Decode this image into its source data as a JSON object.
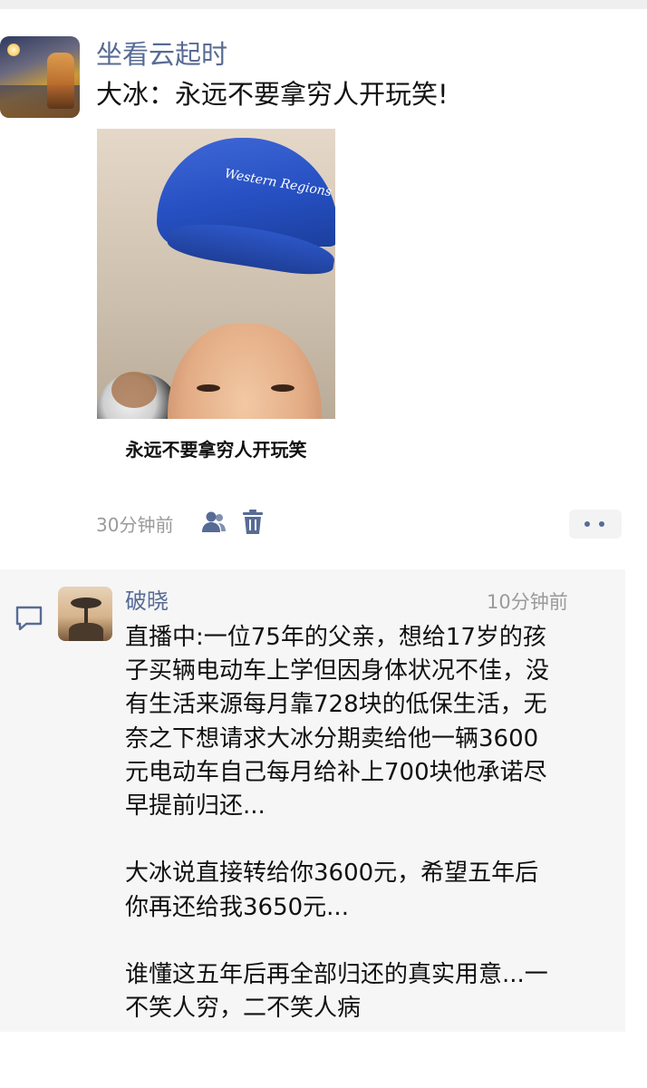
{
  "post": {
    "author": "坐看云起时",
    "text": "大冰：永远不要拿穷人开玩笑!",
    "image": {
      "caption": "永远不要拿穷人开玩笑",
      "cap_text": "Western Regions"
    },
    "time": "30分钟前",
    "icons": [
      "friends-icon",
      "trash-icon",
      "more-icon"
    ]
  },
  "comment": {
    "author": "破晓",
    "time": "10分钟前",
    "lines": [
      "直播中:一位75年的父亲，想给17岁的孩",
      "子买辆电动车上学但因身体状况不佳，没",
      "有生活来源每月靠728块的低保生活，无",
      "奈之下想请求大冰分期卖给他一辆3600",
      "元电动车自己每月给补上700块他承诺尽",
      "早提前归还...",
      "",
      "大冰说直接转给你3600元，希望五年后",
      "你再还给我3650元...",
      "",
      "谁懂这五年后再全部归还的真实用意...一",
      "不笑人穷，二不笑人病"
    ]
  },
  "colors": {
    "link_blue": "#576b95",
    "meta_gray": "#9a9a9a",
    "panel_bg": "#f6f6f6"
  }
}
